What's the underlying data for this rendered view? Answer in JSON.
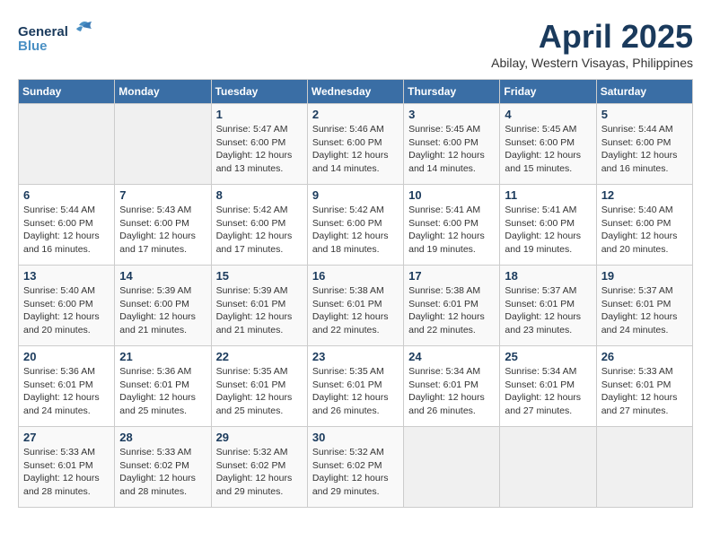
{
  "header": {
    "logo_general": "General",
    "logo_blue": "Blue",
    "month_title": "April 2025",
    "subtitle": "Abilay, Western Visayas, Philippines"
  },
  "days_of_week": [
    "Sunday",
    "Monday",
    "Tuesday",
    "Wednesday",
    "Thursday",
    "Friday",
    "Saturday"
  ],
  "weeks": [
    [
      {
        "day": "",
        "sunrise": "",
        "sunset": "",
        "daylight": ""
      },
      {
        "day": "",
        "sunrise": "",
        "sunset": "",
        "daylight": ""
      },
      {
        "day": "1",
        "sunrise": "Sunrise: 5:47 AM",
        "sunset": "Sunset: 6:00 PM",
        "daylight": "Daylight: 12 hours and 13 minutes."
      },
      {
        "day": "2",
        "sunrise": "Sunrise: 5:46 AM",
        "sunset": "Sunset: 6:00 PM",
        "daylight": "Daylight: 12 hours and 14 minutes."
      },
      {
        "day": "3",
        "sunrise": "Sunrise: 5:45 AM",
        "sunset": "Sunset: 6:00 PM",
        "daylight": "Daylight: 12 hours and 14 minutes."
      },
      {
        "day": "4",
        "sunrise": "Sunrise: 5:45 AM",
        "sunset": "Sunset: 6:00 PM",
        "daylight": "Daylight: 12 hours and 15 minutes."
      },
      {
        "day": "5",
        "sunrise": "Sunrise: 5:44 AM",
        "sunset": "Sunset: 6:00 PM",
        "daylight": "Daylight: 12 hours and 16 minutes."
      }
    ],
    [
      {
        "day": "6",
        "sunrise": "Sunrise: 5:44 AM",
        "sunset": "Sunset: 6:00 PM",
        "daylight": "Daylight: 12 hours and 16 minutes."
      },
      {
        "day": "7",
        "sunrise": "Sunrise: 5:43 AM",
        "sunset": "Sunset: 6:00 PM",
        "daylight": "Daylight: 12 hours and 17 minutes."
      },
      {
        "day": "8",
        "sunrise": "Sunrise: 5:42 AM",
        "sunset": "Sunset: 6:00 PM",
        "daylight": "Daylight: 12 hours and 17 minutes."
      },
      {
        "day": "9",
        "sunrise": "Sunrise: 5:42 AM",
        "sunset": "Sunset: 6:00 PM",
        "daylight": "Daylight: 12 hours and 18 minutes."
      },
      {
        "day": "10",
        "sunrise": "Sunrise: 5:41 AM",
        "sunset": "Sunset: 6:00 PM",
        "daylight": "Daylight: 12 hours and 19 minutes."
      },
      {
        "day": "11",
        "sunrise": "Sunrise: 5:41 AM",
        "sunset": "Sunset: 6:00 PM",
        "daylight": "Daylight: 12 hours and 19 minutes."
      },
      {
        "day": "12",
        "sunrise": "Sunrise: 5:40 AM",
        "sunset": "Sunset: 6:00 PM",
        "daylight": "Daylight: 12 hours and 20 minutes."
      }
    ],
    [
      {
        "day": "13",
        "sunrise": "Sunrise: 5:40 AM",
        "sunset": "Sunset: 6:00 PM",
        "daylight": "Daylight: 12 hours and 20 minutes."
      },
      {
        "day": "14",
        "sunrise": "Sunrise: 5:39 AM",
        "sunset": "Sunset: 6:00 PM",
        "daylight": "Daylight: 12 hours and 21 minutes."
      },
      {
        "day": "15",
        "sunrise": "Sunrise: 5:39 AM",
        "sunset": "Sunset: 6:01 PM",
        "daylight": "Daylight: 12 hours and 21 minutes."
      },
      {
        "day": "16",
        "sunrise": "Sunrise: 5:38 AM",
        "sunset": "Sunset: 6:01 PM",
        "daylight": "Daylight: 12 hours and 22 minutes."
      },
      {
        "day": "17",
        "sunrise": "Sunrise: 5:38 AM",
        "sunset": "Sunset: 6:01 PM",
        "daylight": "Daylight: 12 hours and 22 minutes."
      },
      {
        "day": "18",
        "sunrise": "Sunrise: 5:37 AM",
        "sunset": "Sunset: 6:01 PM",
        "daylight": "Daylight: 12 hours and 23 minutes."
      },
      {
        "day": "19",
        "sunrise": "Sunrise: 5:37 AM",
        "sunset": "Sunset: 6:01 PM",
        "daylight": "Daylight: 12 hours and 24 minutes."
      }
    ],
    [
      {
        "day": "20",
        "sunrise": "Sunrise: 5:36 AM",
        "sunset": "Sunset: 6:01 PM",
        "daylight": "Daylight: 12 hours and 24 minutes."
      },
      {
        "day": "21",
        "sunrise": "Sunrise: 5:36 AM",
        "sunset": "Sunset: 6:01 PM",
        "daylight": "Daylight: 12 hours and 25 minutes."
      },
      {
        "day": "22",
        "sunrise": "Sunrise: 5:35 AM",
        "sunset": "Sunset: 6:01 PM",
        "daylight": "Daylight: 12 hours and 25 minutes."
      },
      {
        "day": "23",
        "sunrise": "Sunrise: 5:35 AM",
        "sunset": "Sunset: 6:01 PM",
        "daylight": "Daylight: 12 hours and 26 minutes."
      },
      {
        "day": "24",
        "sunrise": "Sunrise: 5:34 AM",
        "sunset": "Sunset: 6:01 PM",
        "daylight": "Daylight: 12 hours and 26 minutes."
      },
      {
        "day": "25",
        "sunrise": "Sunrise: 5:34 AM",
        "sunset": "Sunset: 6:01 PM",
        "daylight": "Daylight: 12 hours and 27 minutes."
      },
      {
        "day": "26",
        "sunrise": "Sunrise: 5:33 AM",
        "sunset": "Sunset: 6:01 PM",
        "daylight": "Daylight: 12 hours and 27 minutes."
      }
    ],
    [
      {
        "day": "27",
        "sunrise": "Sunrise: 5:33 AM",
        "sunset": "Sunset: 6:01 PM",
        "daylight": "Daylight: 12 hours and 28 minutes."
      },
      {
        "day": "28",
        "sunrise": "Sunrise: 5:33 AM",
        "sunset": "Sunset: 6:02 PM",
        "daylight": "Daylight: 12 hours and 28 minutes."
      },
      {
        "day": "29",
        "sunrise": "Sunrise: 5:32 AM",
        "sunset": "Sunset: 6:02 PM",
        "daylight": "Daylight: 12 hours and 29 minutes."
      },
      {
        "day": "30",
        "sunrise": "Sunrise: 5:32 AM",
        "sunset": "Sunset: 6:02 PM",
        "daylight": "Daylight: 12 hours and 29 minutes."
      },
      {
        "day": "",
        "sunrise": "",
        "sunset": "",
        "daylight": ""
      },
      {
        "day": "",
        "sunrise": "",
        "sunset": "",
        "daylight": ""
      },
      {
        "day": "",
        "sunrise": "",
        "sunset": "",
        "daylight": ""
      }
    ]
  ]
}
